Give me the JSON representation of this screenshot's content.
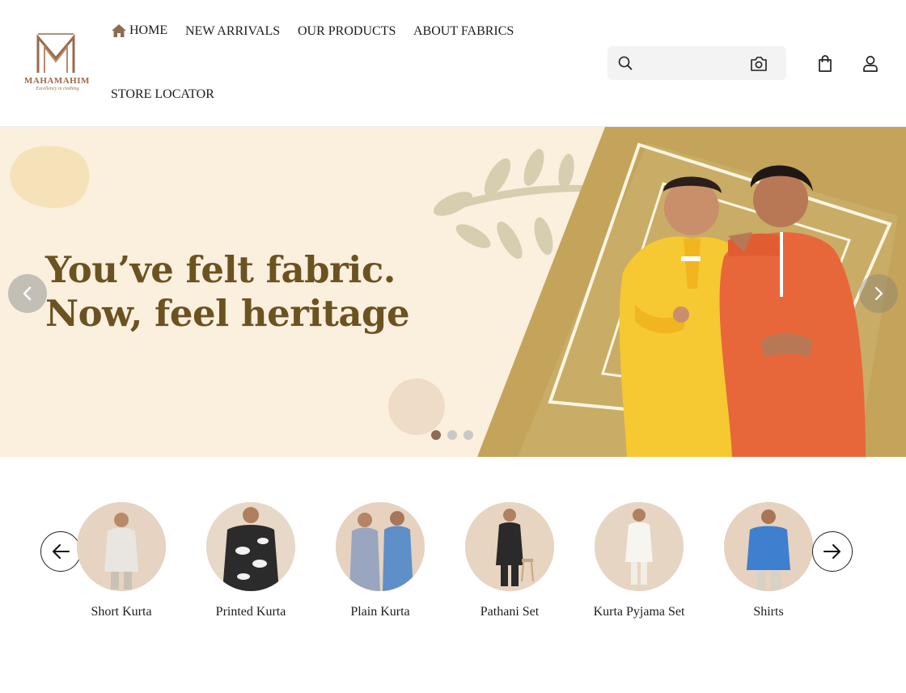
{
  "brand": {
    "name": "MAHAMAHIM",
    "tagline": "Excellency in clothing",
    "color": "#9a6a4c"
  },
  "nav": {
    "home": "HOME",
    "new_arrivals": "NEW ARRIVALS",
    "our_products": "OUR PRODUCTS",
    "about_fabrics": "ABOUT FABRICS",
    "store_locator": "STORE LOCATOR"
  },
  "search": {
    "value": "",
    "placeholder": ""
  },
  "icons": {
    "home": "home-icon",
    "search": "search-icon",
    "camera": "camera-icon",
    "cart": "shopping-bag-icon",
    "account": "user-icon",
    "prev": "chevron-left-icon",
    "next": "chevron-right-icon"
  },
  "hero": {
    "line1": "You’ve felt fabric.",
    "line2": "Now, feel heritage",
    "slides": 3,
    "active_slide": 1,
    "title_color": "#6b5220",
    "background": "#fbefde",
    "accent": "#c4a45a"
  },
  "categories": [
    {
      "label": "Short Kurta",
      "swatch": "#e9e6e1"
    },
    {
      "label": "Printed Kurta",
      "swatch": "#2b2b2b"
    },
    {
      "label": "Plain Kurta",
      "swatch": "#7f9bc6"
    },
    {
      "label": "Pathani Set",
      "swatch": "#2a2a2a"
    },
    {
      "label": "Kurta Pyjama Set",
      "swatch": "#f7f5f0"
    },
    {
      "label": "Shirts",
      "swatch": "#3f7fd0"
    }
  ]
}
